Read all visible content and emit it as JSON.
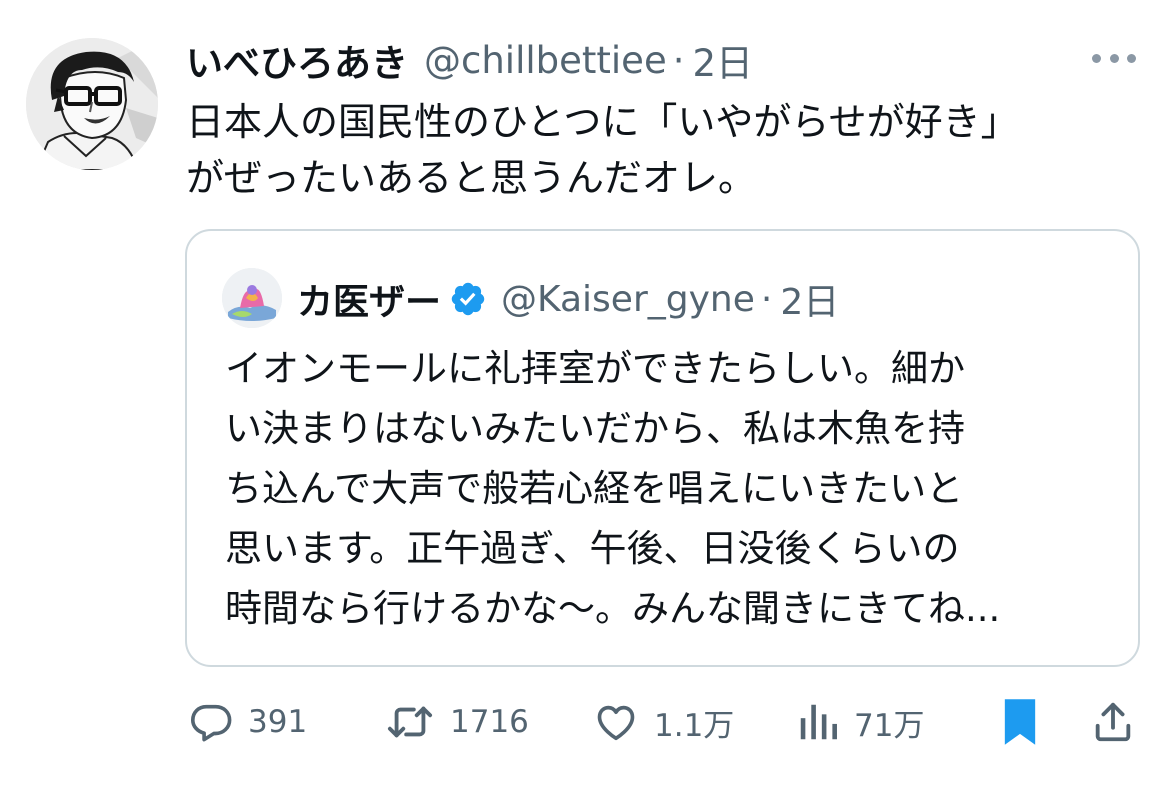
{
  "tweet": {
    "author": {
      "display_name": "いべひろあき",
      "handle": "@chillbettiee",
      "separator": "·",
      "time": "2日"
    },
    "text_lines": [
      "日本人の国民性のひとつに「いやがらせが好き」",
      "がぜったいあると思うんだオレ。"
    ]
  },
  "quote": {
    "author": {
      "display_name": "カ医ザー",
      "handle": "@Kaiser_gyne",
      "separator": "·",
      "time": "2日"
    },
    "text_lines": [
      "イオンモールに礼拝室ができたらしい。細か",
      "い決まりはないみたいだから、私は木魚を持",
      "ち込んで大声で般若心経を唱えにいきたいと",
      "思います。正午過ぎ、午後、日没後くらいの",
      "時間なら行けるかな〜。みんな聞きにきてね..."
    ]
  },
  "actions": {
    "replies": "391",
    "retweets": "1716",
    "likes": "1.1万",
    "views": "71万"
  },
  "icons": {
    "more": "more-dots-icon",
    "reply": "reply-icon",
    "retweet": "retweet-icon",
    "like": "heart-icon",
    "views": "views-chart-icon",
    "bookmark": "bookmark-icon",
    "share": "share-icon",
    "verified": "verified-badge-icon"
  },
  "colors": {
    "text": "#0f1419",
    "secondary": "#536471",
    "border": "#cfd9de",
    "bookmark_active": "#1d9bf0",
    "verified": "#1d9bf0"
  }
}
